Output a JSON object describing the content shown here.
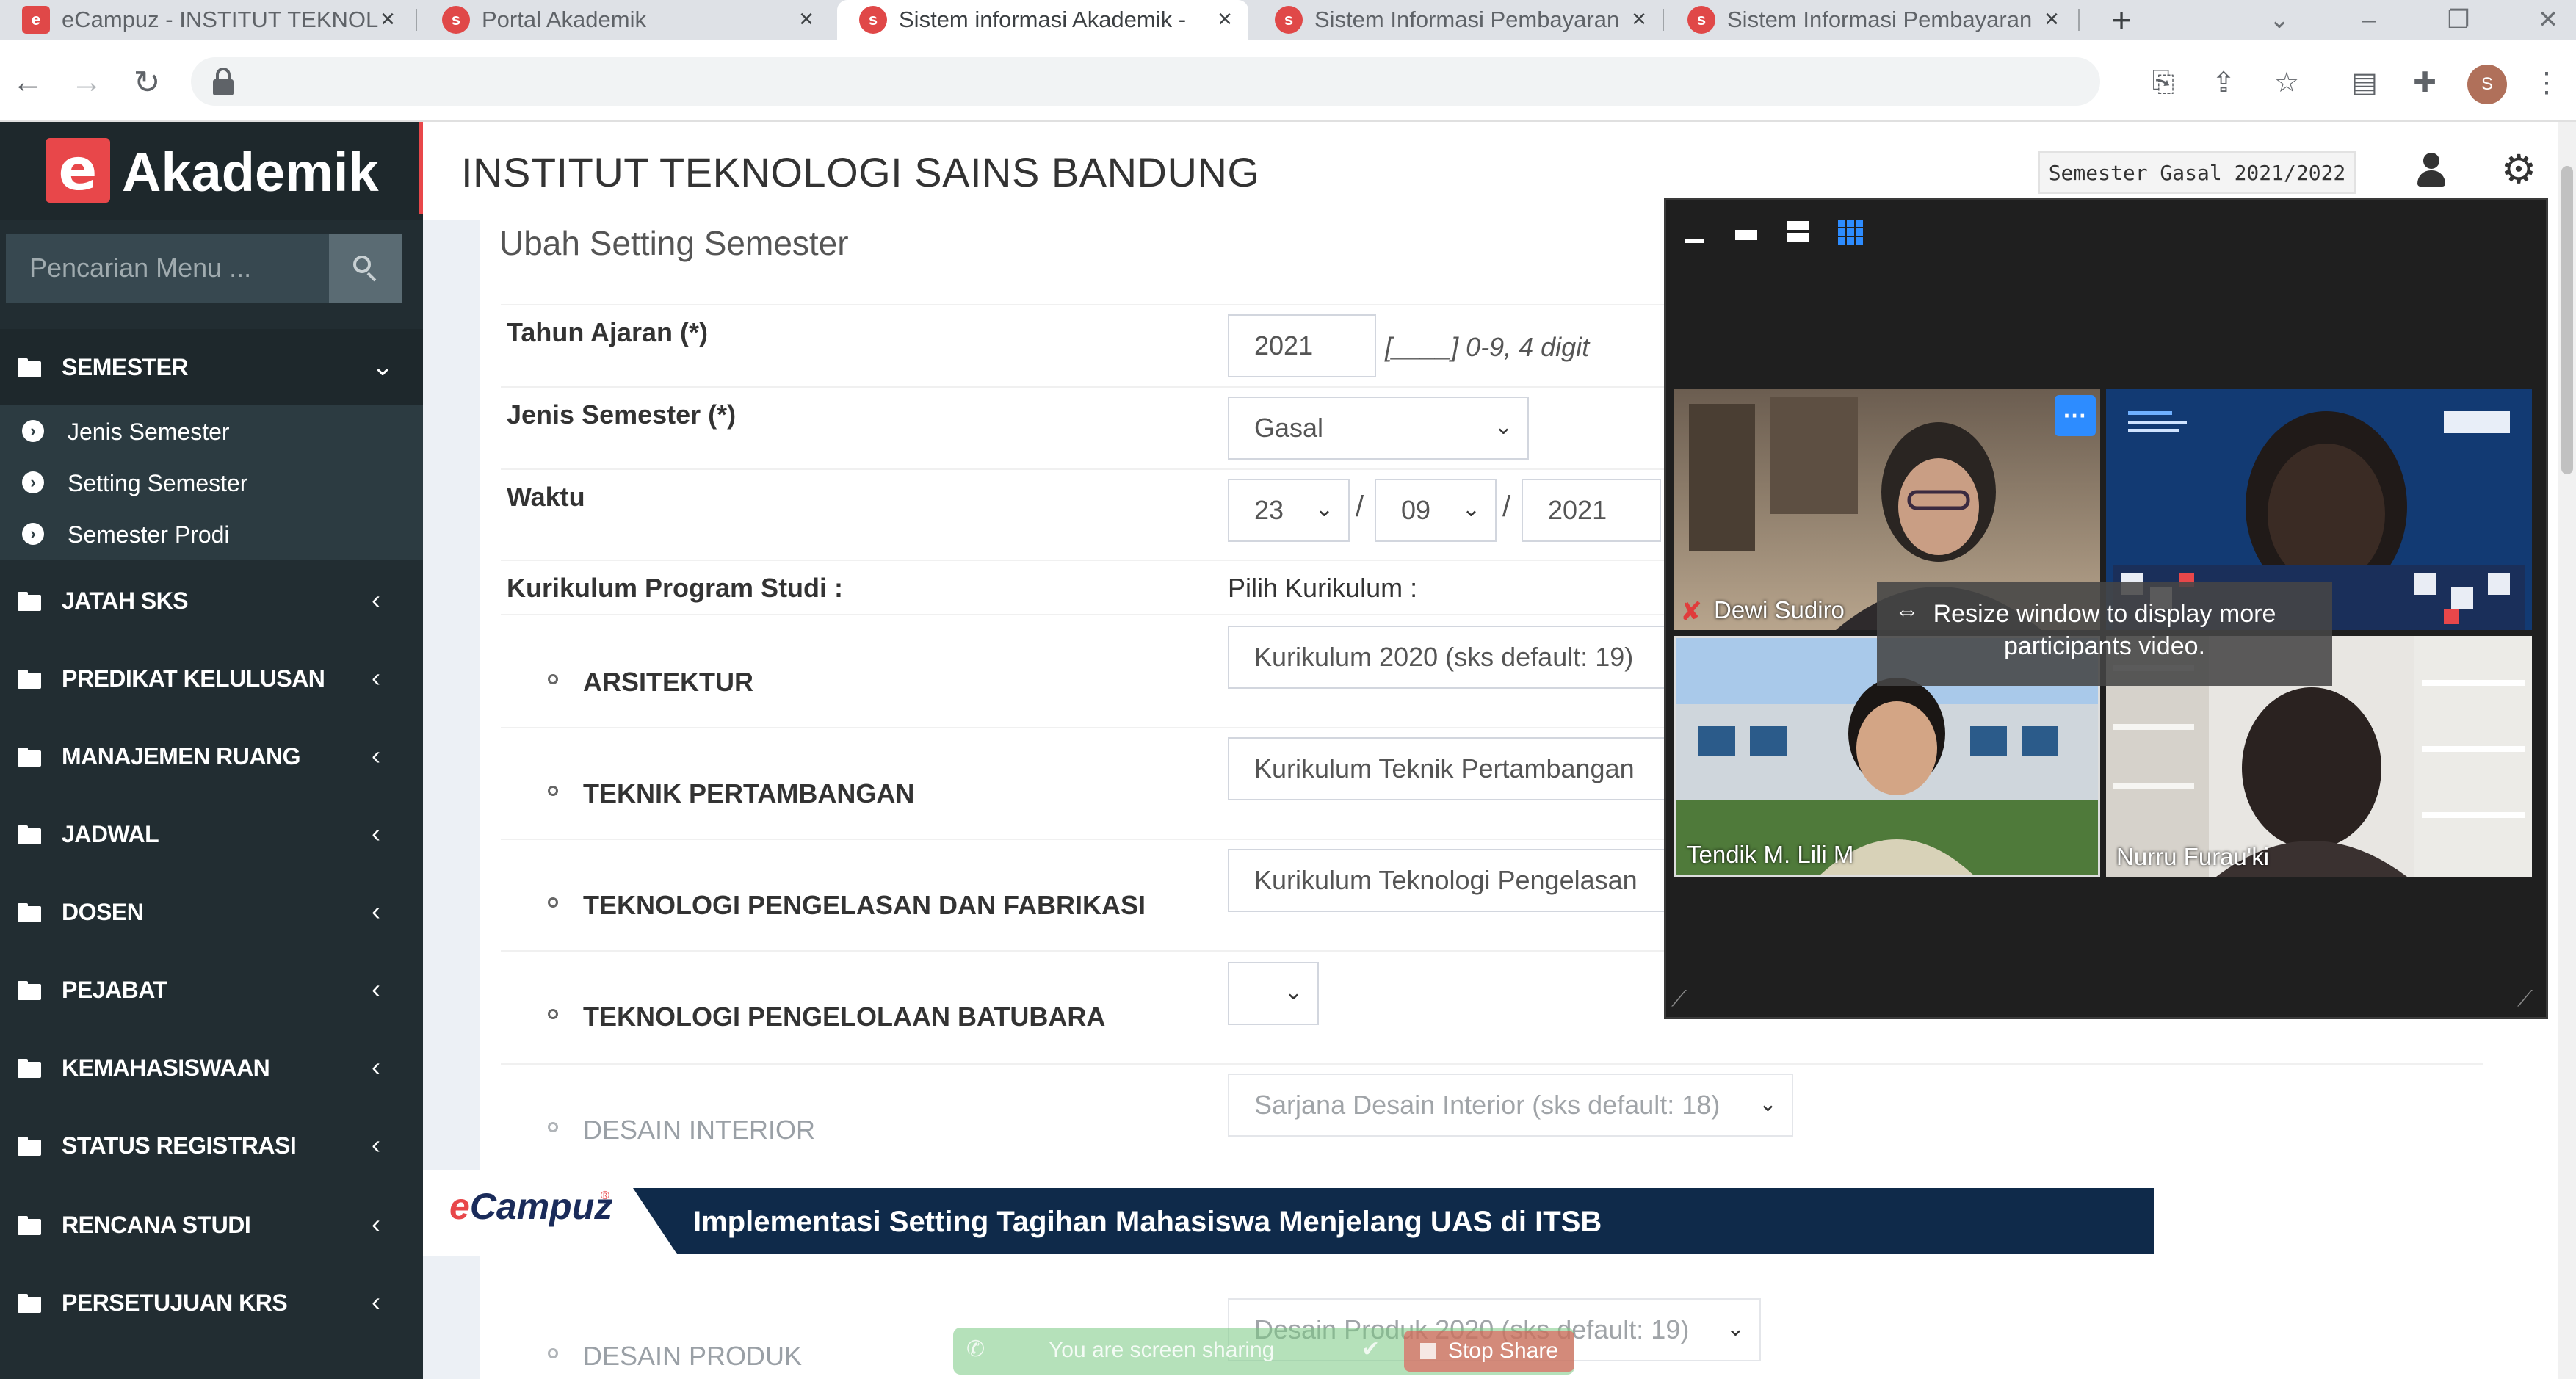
{
  "browser": {
    "tabs": [
      {
        "title": "eCampuz - INSTITUT TEKNOL",
        "active": false
      },
      {
        "title": "Portal Akademik",
        "active": false
      },
      {
        "title": "Sistem informasi Akademik -",
        "active": true
      },
      {
        "title": "Sistem Informasi Pembayaran",
        "active": false
      },
      {
        "title": "Sistem Informasi Pembayaran",
        "active": false
      }
    ],
    "new_tab": "+",
    "profile_initial": "S"
  },
  "sidebar": {
    "brand_letter": "e",
    "brand_text": "Akademik",
    "search_placeholder": "Pencarian Menu ...",
    "open_menu": {
      "label": "SEMESTER",
      "items": [
        "Jenis Semester",
        "Setting Semester",
        "Semester Prodi"
      ]
    },
    "menus": [
      "JATAH SKS",
      "PREDIKAT KELULUSAN",
      "MANAJEMEN RUANG",
      "JADWAL",
      "DOSEN",
      "PEJABAT",
      "KEMAHASISWAAN",
      "STATUS REGISTRASI",
      "RENCANA STUDI",
      "PERSETUJUAN KRS"
    ]
  },
  "header": {
    "institution": "INSTITUT TEKNOLOGI SAINS BANDUNG",
    "semester": "Semester Gasal 2021/2022"
  },
  "form": {
    "title": "Ubah Setting Semester",
    "tahun_ajaran": {
      "label": "Tahun Ajaran (*)",
      "value": "2021",
      "hint": "[____] 0-9, 4 digit"
    },
    "jenis_semester": {
      "label": "Jenis Semester (*)",
      "value": "Gasal"
    },
    "waktu": {
      "label": "Waktu",
      "day": "23",
      "month": "09",
      "year": "2021",
      "sep": "/"
    },
    "kurikulum": {
      "label": "Kurikulum Program Studi :",
      "pick_label": "Pilih Kurikulum :",
      "rows": [
        {
          "prodi": "ARSITEKTUR",
          "value": "Kurikulum 2020 (sks default: 19)"
        },
        {
          "prodi": "TEKNIK PERTAMBANGAN",
          "value": "Kurikulum Teknik Pertambangan"
        },
        {
          "prodi": "TEKNOLOGI PENGELASAN DAN FABRIKASI",
          "value": "Kurikulum Teknologi Pengelasan"
        },
        {
          "prodi": "TEKNOLOGI PENGELOLAAN BATUBARA",
          "value": ""
        },
        {
          "prodi": "DESAIN INTERIOR",
          "value": "Sarjana Desain Interior (sks default: 18)"
        },
        {
          "prodi": "DESAIN PRODUK",
          "value": "Desain Produk 2020 (sks default: 19)"
        }
      ]
    }
  },
  "video": {
    "participants": [
      "Dewi Sudiro",
      "Tendik M. Lili M",
      "Nurru Furau'ki"
    ],
    "more_label": "···",
    "resize_tip": "Resize window to display more participants video."
  },
  "banner": {
    "logo_e": "e",
    "logo_rest": "Campuz",
    "reg": "®",
    "text": "Implementasi Setting Tagihan Mahasiswa Menjelang UAS di ITSB"
  },
  "share_bar": {
    "text": "You are screen sharing",
    "stop": "Stop Share"
  }
}
